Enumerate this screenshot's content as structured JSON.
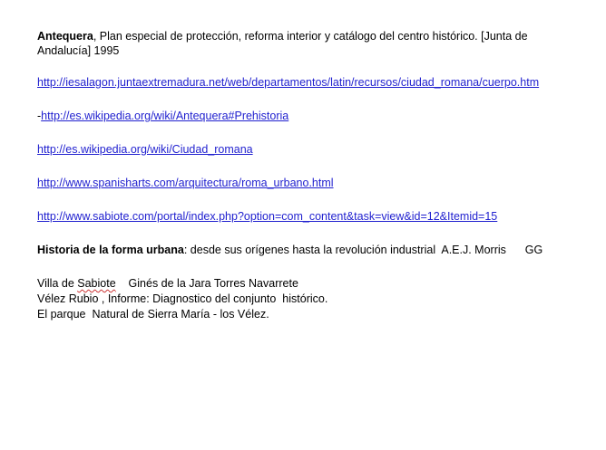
{
  "references": {
    "antequera": {
      "bold": "Antequera",
      "rest": ", Plan especial de protección, reforma interior y catálogo del centro histórico. [Junta de Andalucía] 1995"
    },
    "link1": "http://iesalagon.juntaextremadura.net/web/departamentos/latin/recursos/ciudad_romana/cuerpo.htm",
    "link2_prefix": "-",
    "link2": "http://es.wikipedia.org/wiki/Antequera#Prehistoria",
    "link3": "http://es.wikipedia.org/wiki/Ciudad_romana",
    "link4": "http://www.spanisharts.com/arquitectura/roma_urbano.html",
    "link5": "http://www.sabiote.com/portal/index.php?option=com_content&task=view&id=12&Itemid=15",
    "historia": {
      "bold": "Historia de la forma urbana",
      "rest": ": desde sus orígenes hasta la revolución industrial  A.E.J. Morris      GG"
    },
    "sabiote": {
      "prefix": "Villa de ",
      "word": "Sabiote",
      "rest": "    Ginés de la Jara Torres Navarrete"
    },
    "velez": "Vélez Rubio , Informe: Diagnostico del conjunto  histórico.",
    "parque": "El parque  Natural de Sierra María - los Vélez."
  }
}
